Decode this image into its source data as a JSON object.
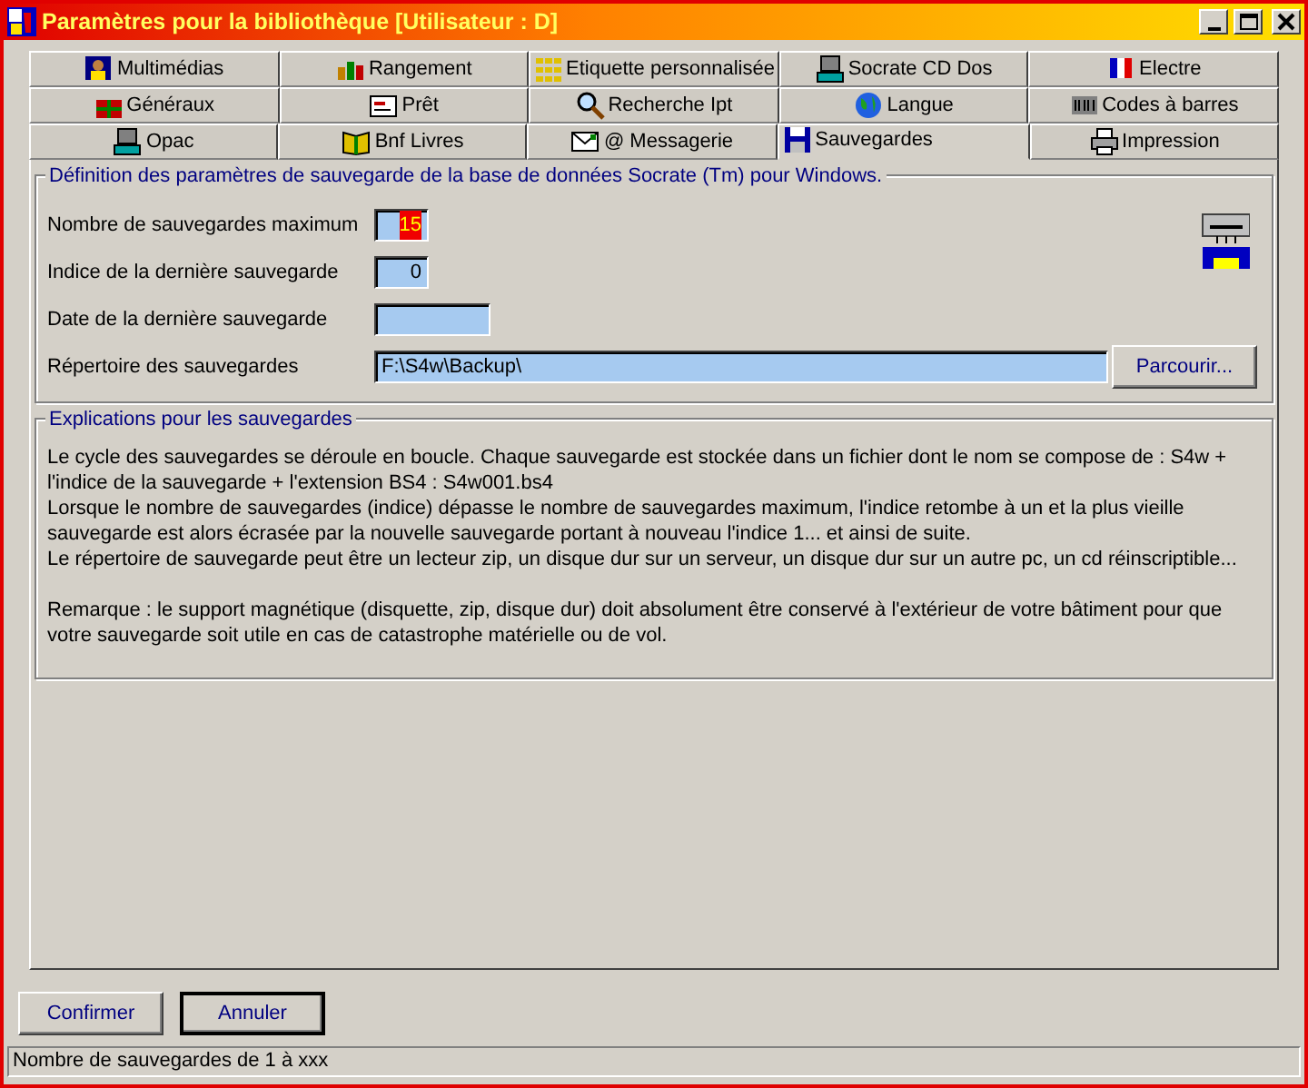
{
  "window": {
    "title": "Paramètres pour la bibliothèque [Utilisateur : D]"
  },
  "tab_rows": [
    [
      {
        "label": "Multimédias",
        "selected": false
      },
      {
        "label": "Rangement",
        "selected": false
      },
      {
        "label": "Etiquette personnalisée",
        "selected": false
      },
      {
        "label": "Socrate CD Dos",
        "selected": false
      },
      {
        "label": "Electre",
        "selected": false
      }
    ],
    [
      {
        "label": "Généraux",
        "selected": false
      },
      {
        "label": "Prêt",
        "selected": false
      },
      {
        "label": "Recherche Ipt",
        "selected": false
      },
      {
        "label": "Langue",
        "selected": false
      },
      {
        "label": "Codes à barres",
        "selected": false
      }
    ],
    [
      {
        "label": "Opac",
        "selected": false
      },
      {
        "label": "Bnf Livres",
        "selected": false
      },
      {
        "label": "@ Messagerie",
        "selected": false
      },
      {
        "label": "Sauvegardes",
        "selected": true
      },
      {
        "label": "Impression",
        "selected": false
      }
    ]
  ],
  "backup_settings": {
    "title": "Définition des paramètres de sauvegarde de la base de données Socrate (Tm) pour Windows.",
    "fields": [
      {
        "label": "Nombre de sauvegardes maximum",
        "value": "15",
        "kind": "number",
        "text_selected": true
      },
      {
        "label": "Indice de la dernière sauvegarde",
        "value": "0",
        "kind": "number",
        "text_selected": false
      },
      {
        "label": "Date de la dernière sauvegarde",
        "kind": "date"
      },
      {
        "label": "Répertoire des sauvegardes",
        "value": "F:\\S4w\\Backup\\",
        "kind": "path",
        "text_selected": false,
        "button": "Parcourir..."
      }
    ]
  },
  "explanations": {
    "title": "Explications pour les sauvegardes",
    "paragraphs": [
      "Le cycle des sauvegardes se déroule en boucle. Chaque sauvegarde est stockée dans un fichier dont le nom se compose de : S4w + l'indice de la sauvegarde + l'extension BS4 : S4w001.bs4",
      "Lorsque le nombre de sauvegardes (indice) dépasse le nombre de sauvegardes maximum, l'indice retombe à un et la plus vieille sauvegarde est alors écrasée par la nouvelle sauvegarde portant à nouveau l'indice 1... et ainsi de suite.",
      "Le répertoire de sauvegarde peut être un lecteur zip, un disque dur sur un serveur, un disque dur sur un autre pc, un cd réinscriptible..."
    ],
    "remark": "Remarque : le support magnétique (disquette, zip, disque dur) doit absolument être conservé à l'extérieur de votre bâtiment pour que votre sauvegarde soit utile en cas de catastrophe matérielle ou de vol."
  },
  "buttons": [
    {
      "label": "Confirmer",
      "default": false
    },
    {
      "label": "Annuler",
      "default": true
    }
  ],
  "status_bar": "Nombre de sauvegardes de 1 à xxx"
}
